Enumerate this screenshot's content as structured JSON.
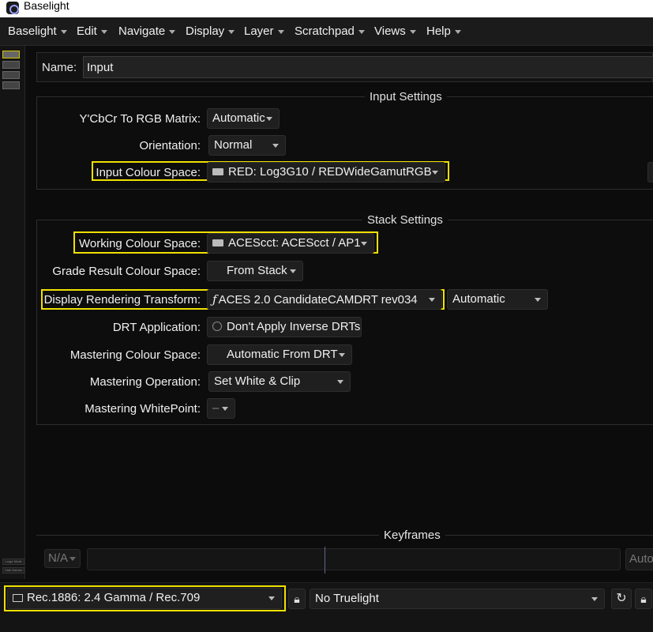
{
  "window": {
    "title": "Baselight"
  },
  "menu": [
    {
      "label": "Baselight"
    },
    {
      "label": "Edit"
    },
    {
      "label": "Navigate"
    },
    {
      "label": "Display"
    },
    {
      "label": "Layer"
    },
    {
      "label": "Scratchpad"
    },
    {
      "label": "Views"
    },
    {
      "label": "Help"
    }
  ],
  "sidebar": {
    "large_mode": "Large Mode",
    "hide_names": "Hide Names"
  },
  "name_field": {
    "label": "Name:",
    "value": "Input"
  },
  "input_settings": {
    "title": "Input Settings",
    "ycbcr_label": "Y'CbCr To RGB Matrix:",
    "ycbcr_value": "Automatic",
    "orientation_label": "Orientation:",
    "orientation_value": "Normal",
    "colour_space_label": "Input Colour Space:",
    "colour_space_value": "RED: Log3G10 / REDWideGamutRGB"
  },
  "stack_settings": {
    "title": "Stack Settings",
    "working_label": "Working Colour Space:",
    "working_value": "ACEScct: ACEScct / AP1",
    "grade_result_label": "Grade Result Colour Space:",
    "grade_result_value": "From Stack",
    "drt_label": "Display Rendering Transform:",
    "drt_value": "ACES 2.0 CandidateCAMDRT rev034",
    "drt_option": "Automatic",
    "drt_app_label": "DRT Application:",
    "drt_app_value": "Don't Apply Inverse DRTs",
    "mastering_cs_label": "Mastering Colour Space:",
    "mastering_cs_value": "Automatic From DRT",
    "mastering_op_label": "Mastering Operation:",
    "mastering_op_value": "Set White & Clip",
    "mastering_wp_label": "Mastering WhitePoint:",
    "mastering_wp_value": "–"
  },
  "keyframes": {
    "title": "Keyframes",
    "mode": "N/A",
    "auto": "Auto"
  },
  "bottom": {
    "display": "Rec.1886: 2.4 Gamma / Rec.709",
    "truelight": "No Truelight"
  },
  "colors": {
    "highlight": "#f0e000",
    "background": "#0c0c0c"
  },
  "icons": [
    "camera-icon",
    "fx-icon",
    "monitor-icon",
    "lock-icon",
    "refresh-icon"
  ]
}
